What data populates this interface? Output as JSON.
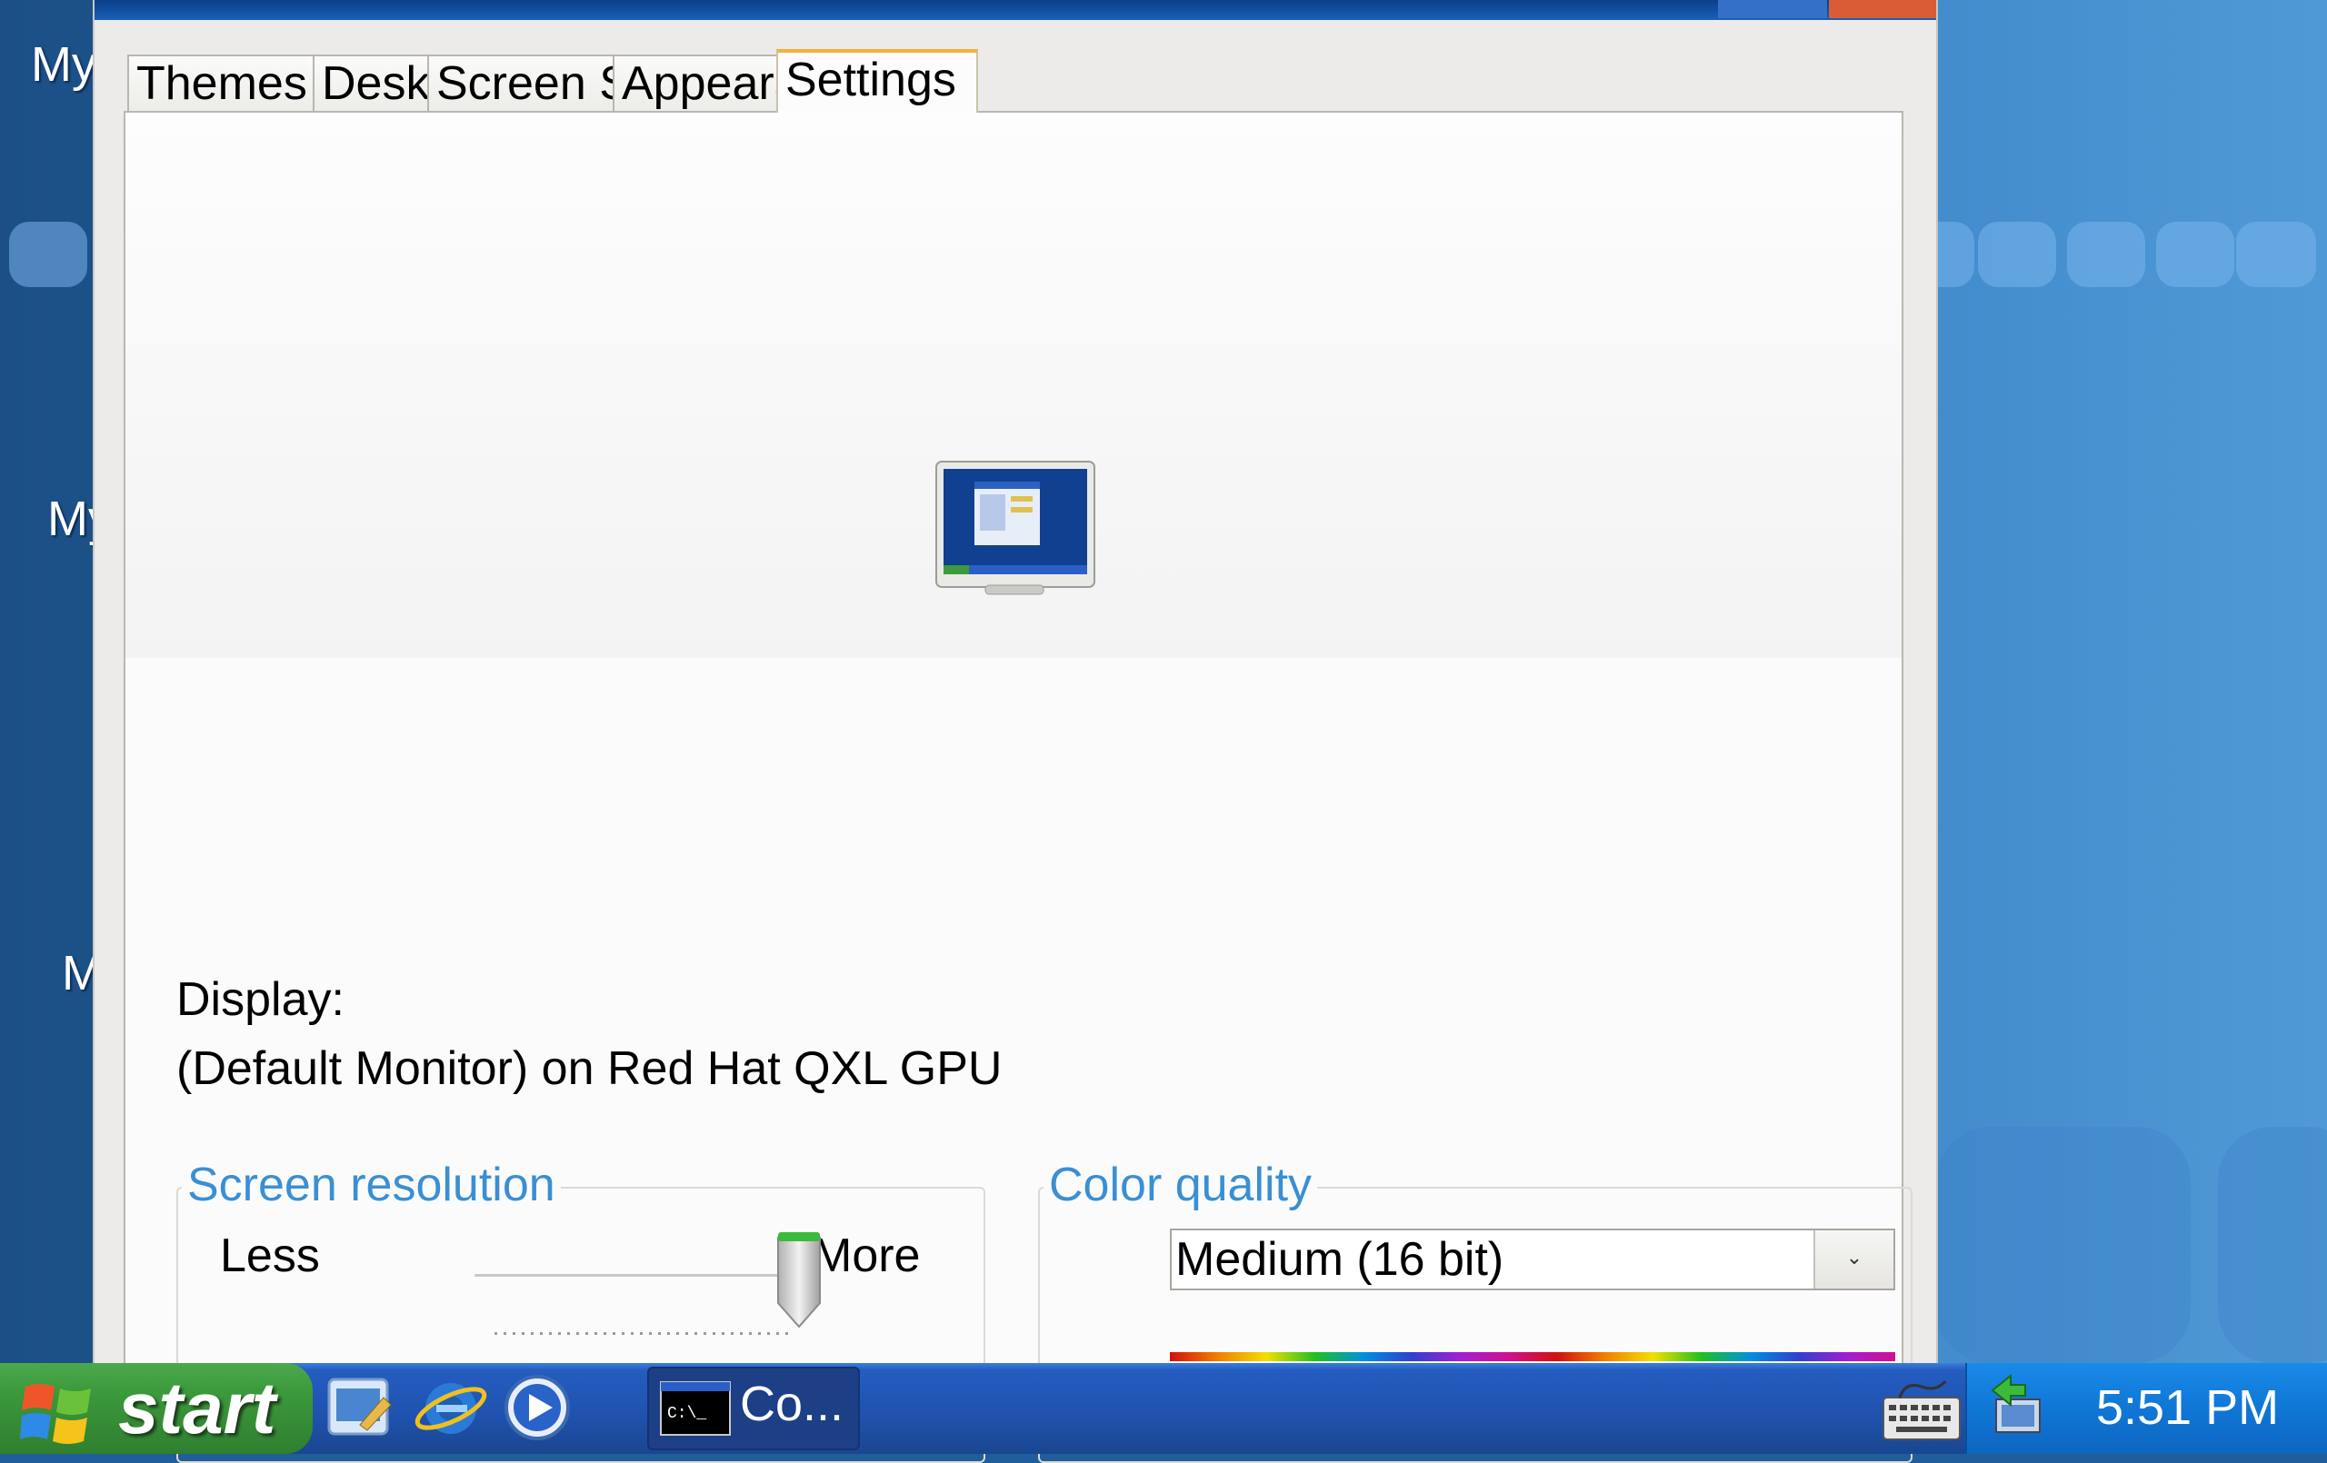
{
  "desktop": {
    "icon_labels": [
      "My",
      "My",
      "M"
    ]
  },
  "dialog": {
    "tabs": [
      {
        "label": "Themes",
        "active": false
      },
      {
        "label": "Desktop",
        "active": false
      },
      {
        "label": "Screen Saver",
        "active": false
      },
      {
        "label": "Appearance",
        "active": false
      },
      {
        "label": "Settings",
        "active": true
      }
    ],
    "display_label": "Display:",
    "display_value": "(Default Monitor) on Red Hat QXL GPU",
    "screen_resolution": {
      "title": "Screen resolution",
      "less_label": "Less",
      "more_label": "More",
      "slider_level": 1.0
    },
    "color_quality": {
      "title": "Color quality",
      "selected": "Medium (16 bit)"
    }
  },
  "taskbar": {
    "start_label": "start",
    "quick_launch": [
      "show-desktop-icon",
      "internet-explorer-icon",
      "media-player-icon"
    ],
    "tasks": [
      {
        "label": "Co...",
        "icon": "command-prompt-icon"
      }
    ],
    "tray_icons": [
      "keyboard-icon",
      "network-icon"
    ],
    "clock": "5:51 PM"
  },
  "colors": {
    "accent_title": "#3a8fd4",
    "tab_highlight": "#f1b33b",
    "start_green": "#3c9a3c",
    "taskbar_blue": "#1f52ad"
  }
}
